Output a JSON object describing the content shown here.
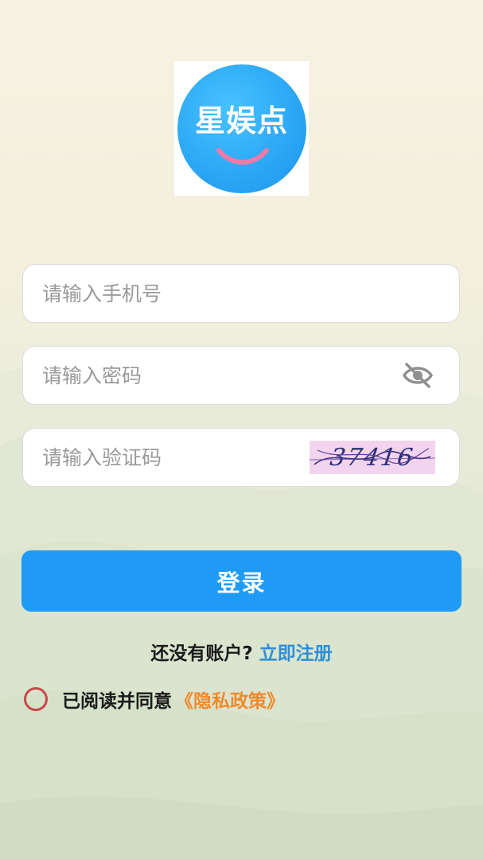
{
  "logo": {
    "text": "星娱点"
  },
  "form": {
    "phone_placeholder": "请输入手机号",
    "password_placeholder": "请输入密码",
    "captcha_placeholder": "请输入验证码",
    "captcha_code": "37416"
  },
  "icons": {
    "password_toggle": "eye-off-icon"
  },
  "login_button": "登录",
  "register": {
    "question": "还没有账户?",
    "link": "立即注册"
  },
  "agreement": {
    "text": "已阅读并同意",
    "policy_link": "《隐私政策》",
    "checked": false
  },
  "colors": {
    "primary": "#1f9bf5",
    "register_link": "#2d8fd6",
    "policy_link": "#ef8a2b",
    "radio_border": "#c9474a",
    "logo_blue": "#2aa6f4"
  }
}
